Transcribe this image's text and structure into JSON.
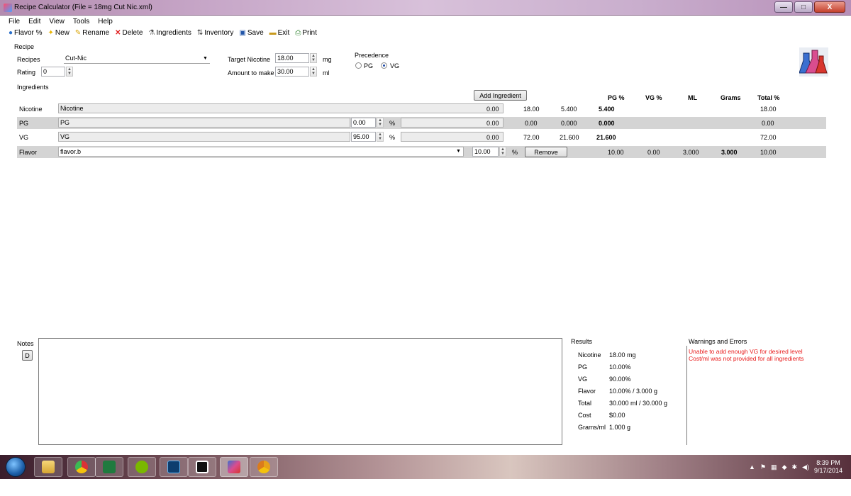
{
  "window": {
    "title": "Recipe Calculator (File = 18mg Cut Nic.xml)",
    "controls": {
      "minimize": "—",
      "maximize": "□",
      "close": "X"
    }
  },
  "menu": [
    "File",
    "Edit",
    "View",
    "Tools",
    "Help"
  ],
  "toolbar": [
    {
      "label": "Flavor %",
      "icon": "globe-icon"
    },
    {
      "label": "New",
      "icon": "new-star-icon"
    },
    {
      "label": "Rename",
      "icon": "rename-icon"
    },
    {
      "label": "Delete",
      "icon": "delete-x-icon"
    },
    {
      "label": "Ingredients",
      "icon": "ingredients-icon"
    },
    {
      "label": "Inventory",
      "icon": "inventory-icon"
    },
    {
      "label": "Save",
      "icon": "save-disk-icon"
    },
    {
      "label": "Exit",
      "icon": "exit-icon"
    },
    {
      "label": "Print",
      "icon": "print-icon"
    }
  ],
  "recipe": {
    "section_label": "Recipe",
    "recipes_label": "Recipes",
    "recipe_value": "Cut-Nic",
    "rating_label": "Rating",
    "rating_value": "0",
    "target_nicotine_label": "Target Nicotine",
    "target_nicotine_value": "18.00",
    "target_nicotine_unit": "mg",
    "amount_label": "Amount to make",
    "amount_value": "30.00",
    "amount_unit": "ml",
    "precedence_label": "Precedence",
    "precedence_options": [
      "PG",
      "VG"
    ],
    "precedence_selected": "VG"
  },
  "ingredients": {
    "section_label": "Ingredients",
    "add_button": "Add Ingredient",
    "headers": [
      "PG %",
      "VG %",
      "ML",
      "Grams",
      "Total %"
    ],
    "nicotine": {
      "label": "Nicotine",
      "name": "Nicotine",
      "cost": "0.00",
      "c1": "18.00",
      "c2": "5.400",
      "ml": "5.400",
      "total": "18.00"
    },
    "pg": {
      "label": "PG",
      "name": "PG",
      "pct": "0.00",
      "pct_unit": "%",
      "cost": "0.00",
      "c1": "0.00",
      "c2": "0.000",
      "ml": "0.000",
      "total": "0.00"
    },
    "vg": {
      "label": "VG",
      "name": "VG",
      "pct": "95.00",
      "pct_unit": "%",
      "cost": "0.00",
      "c1": "72.00",
      "c2": "21.600",
      "ml": "21.600",
      "total": "72.00"
    },
    "flavor": {
      "label": "Flavor",
      "name": "flavor.b",
      "pct": "10.00",
      "pct_unit": "%",
      "remove_button": "Remove",
      "pg": "10.00",
      "vg": "0.00",
      "ml": "3.000",
      "grams": "3.000",
      "total": "10.00"
    }
  },
  "notes": {
    "label": "Notes",
    "button": "D",
    "text": ""
  },
  "results": {
    "label": "Results",
    "rows": [
      {
        "k": "Nicotine",
        "v": "18.00 mg"
      },
      {
        "k": "PG",
        "v": "10.00%"
      },
      {
        "k": "VG",
        "v": "90.00%"
      },
      {
        "k": "Flavor",
        "v": "10.00% / 3.000 g"
      },
      {
        "k": "Total",
        "v": "30.000 ml / 30.000 g"
      },
      {
        "k": "Cost",
        "v": "$0.00"
      },
      {
        "k": "Grams/ml",
        "v": "1.000 g"
      }
    ]
  },
  "warnings": {
    "label": "Warnings and Errors",
    "items": [
      "Unable to add enough VG for desired level",
      "Cost/ml was not provided for all ingredients"
    ],
    "color": "#e81b1b"
  },
  "taskbar": {
    "apps": [
      "explorer-icon",
      "chrome-icon",
      "excel-icon",
      "spotify-icon",
      "photoshop-icon",
      "7zip-icon",
      "recipe-calculator-icon",
      "chrome-canary-icon"
    ],
    "time": "8:39 PM",
    "date": "9/17/2014"
  }
}
